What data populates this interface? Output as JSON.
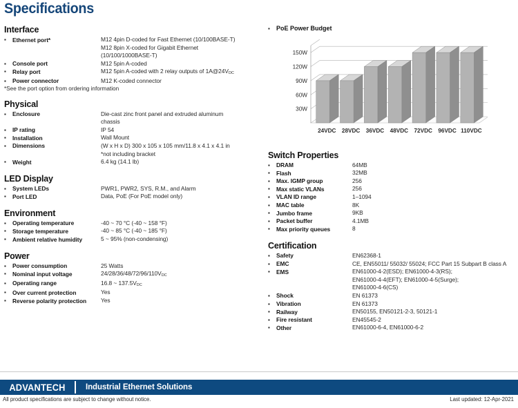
{
  "title": "Specifications",
  "accent_color": "#154679",
  "footer_bar_color": "#0e4a80",
  "bar_fill_color": "#b3b3b3",
  "sections_left": [
    {
      "heading": "Interface",
      "rows": [
        {
          "label": "Ethernet port*",
          "value": "M12 4pin D-coded for Fast Ethernet (10/100BASE-T)\nM12 8pin X-coded for Gigabit Ethernet\n(10/100/1000BASE-T)"
        },
        {
          "label": "Console port",
          "value": "M12 5pin A-coded"
        },
        {
          "label": "Relay port",
          "value": "M12 5pin A-coded with 2 relay outputs of 1A@24V",
          "value_sub": "DC"
        },
        {
          "label": "Power connector",
          "value": "M12 K-coded connector"
        }
      ],
      "note": "*See the port option from ordering information"
    },
    {
      "heading": "Physical",
      "rows": [
        {
          "label": "Enclosure",
          "value": "Die-cast zinc front panel and extruded aluminum\nchassis"
        },
        {
          "label": "IP rating",
          "value": "IP 54"
        },
        {
          "label": "Installation",
          "value": "Wall Mount"
        },
        {
          "label": "Dimensions",
          "value": "(W x H x D) 300 x 105 x 105 mm/11.8 x 4.1 x 4.1 in\n*not including bracket"
        },
        {
          "label": "Weight",
          "value": "6.4 kg (14.1 lb)"
        }
      ]
    },
    {
      "heading": "LED Display",
      "rows": [
        {
          "label": "System LEDs",
          "value": "PWR1, PWR2, SYS, R.M., and Alarm"
        },
        {
          "label": "Port LED",
          "value": "Data, PoE (For PoE model only)"
        }
      ]
    },
    {
      "heading": "Environment",
      "rows": [
        {
          "label": "Operating temperature",
          "value": "-40 ~ 70 °C (-40 ~ 158 °F)"
        },
        {
          "label": "Storage temperature",
          "value": "-40 ~ 85 °C (-40 ~ 185 °F)"
        },
        {
          "label": "Ambient relative humidity",
          "value": "5 ~ 95% (non-condensing)"
        }
      ]
    },
    {
      "heading": "Power",
      "rows": [
        {
          "label": "Power consumption",
          "value": "25 Watts"
        },
        {
          "label": "Nominal input voltage",
          "value": "24/28/36/48/72/96/110V",
          "value_sub": "DC"
        },
        {
          "label": "Operating range",
          "value": "16.8 ~ 137.5V",
          "value_sub": "DC"
        },
        {
          "label": "Over current protection",
          "value": "Yes"
        },
        {
          "label": "Reverse polarity protection",
          "value": "Yes"
        }
      ]
    }
  ],
  "chart_title": "PoE Power Budget",
  "chart_data": {
    "type": "bar",
    "title": "PoE Power Budget",
    "categories": [
      "24VDC",
      "28VDC",
      "36VDC",
      "48VDC",
      "72VDC",
      "96VDC",
      "110VDC"
    ],
    "values": [
      90,
      90,
      120,
      120,
      150,
      150,
      150
    ],
    "xlabel": "",
    "ylabel": "",
    "ylim": [
      0,
      165
    ],
    "yticks": [
      30,
      60,
      90,
      120,
      150
    ],
    "ytick_labels": [
      "30W",
      "60W",
      "90W",
      "120W",
      "150W"
    ],
    "grid": true,
    "legend": "none",
    "style": "3d-column"
  },
  "sections_right": [
    {
      "heading": "Switch Properties",
      "rows": [
        {
          "label": "DRAM",
          "value": "64MB"
        },
        {
          "label": "Flash",
          "value": "32MB"
        },
        {
          "label": "Max. IGMP group",
          "value": "256"
        },
        {
          "label": "Max static VLANs",
          "value": "256"
        },
        {
          "label": "VLAN ID range",
          "value": "1–1094"
        },
        {
          "label": "MAC table",
          "value": "8K"
        },
        {
          "label": "Jumbo frame",
          "value": "9KB"
        },
        {
          "label": "Packet buffer",
          "value": "4.1MB"
        },
        {
          "label": "Max priority queues",
          "value": "8"
        }
      ]
    },
    {
      "heading": "Certification",
      "rows": [
        {
          "label": "Safety",
          "value": "EN62368-1"
        },
        {
          "label": "EMC",
          "value": "CE, EN55011/ 55032/ 55024; FCC Part 15 Subpart B class A"
        },
        {
          "label": "EMS",
          "value": "EN61000-4-2(ESD); EN61000-4-3(RS);\nEN61000-4-4(EFT); EN61000-4-5(Surge);\nEN61000-4-6(CS)"
        },
        {
          "label": "Shock",
          "value": "EN 61373"
        },
        {
          "label": "Vibration",
          "value": "EN 61373"
        },
        {
          "label": "Railway",
          "value": "EN50155, EN50121-2-3, 50121-1"
        },
        {
          "label": "Fire resistant",
          "value": "EN45545-2"
        },
        {
          "label": "Other",
          "value": "EN61000-6-4, EN61000-6-2"
        }
      ]
    }
  ],
  "footer": {
    "brand": "ADVANTECH",
    "tagline": "Industrial Ethernet Solutions",
    "disclaimer": "All product specifications are subject to change without notice.",
    "updated": "Last updated: 12-Apr-2021"
  }
}
